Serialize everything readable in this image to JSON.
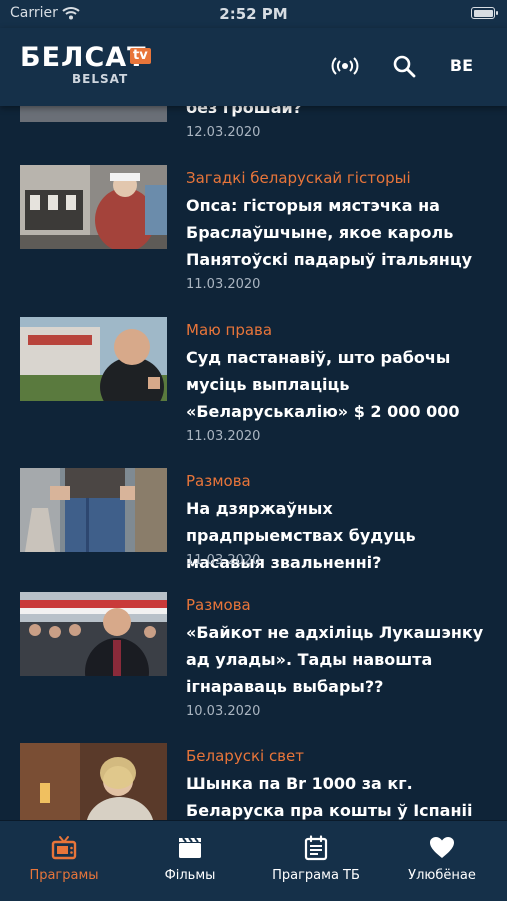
{
  "status_bar": {
    "carrier": "Carrier",
    "time": "2:52 PM"
  },
  "header": {
    "logo_main": "БЕЛСАТ",
    "logo_tv": "tv",
    "logo_sub": "BELSAT",
    "language": "BE",
    "icons": [
      "live-broadcast-icon",
      "search-icon"
    ]
  },
  "feed": {
    "items": [
      {
        "category": "",
        "title": "без грошай?",
        "date": "12.03.2020"
      },
      {
        "category": "Загадкі беларускай гісторыі",
        "title": "Опса: гісторыя мястэчка на Браслаўшчыне, якое кароль Панятоўскі падарыў італьянцу",
        "date": "11.03.2020"
      },
      {
        "category": "Маю права",
        "title": "Суд пастанавіў, што рабочы мусіць выплаціць «Беларуськалію» $ 2 000 000",
        "date": "11.03.2020"
      },
      {
        "category": "Размова",
        "title": "На дзяржаўных прадпрыемствах будуць масавыя звальненні?",
        "date": "11.03.2020"
      },
      {
        "category": "Размова",
        "title": "«Байкот не адхіліць Лукашэнку ад улады». Тады навошта ігнараваць выбары??",
        "date": "10.03.2020"
      },
      {
        "category": "Беларускі свет",
        "title": "Шынка па Br 1000 за кг. Беларуска пра кошты ў Іспаніі",
        "date": ""
      }
    ]
  },
  "tabbar": {
    "tabs": [
      {
        "label": "Праграмы",
        "icon": "tv-icon",
        "active": true
      },
      {
        "label": "Фільмы",
        "icon": "clapperboard-icon",
        "active": false
      },
      {
        "label": "Праграма ТБ",
        "icon": "schedule-icon",
        "active": false
      },
      {
        "label": "Улюбёнае",
        "icon": "heart-icon",
        "active": false
      }
    ]
  },
  "colors": {
    "background": "#0f2438",
    "bar": "#153049",
    "accent": "#e8753a",
    "text": "#ffffff",
    "muted": "#aab5c1"
  }
}
